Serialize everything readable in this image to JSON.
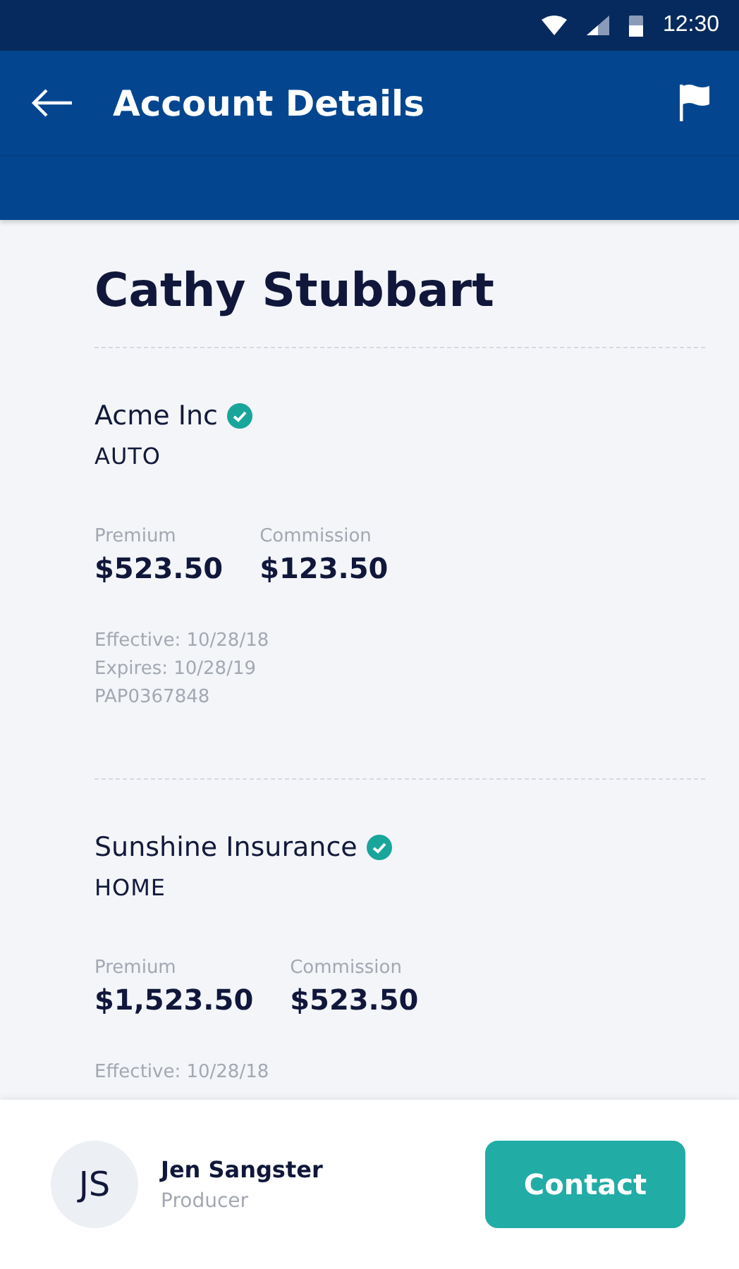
{
  "status_bar": {
    "time": "12:30"
  },
  "app_bar": {
    "title": "Account Details"
  },
  "account": {
    "name": "Cathy Stubbart"
  },
  "policies": [
    {
      "company": "Acme Inc",
      "verified": true,
      "line": "AUTO",
      "premium_label": "Premium",
      "premium": "$523.50",
      "commission_label": "Commission",
      "commission": "$123.50",
      "details": [
        "Effective: 10/28/18",
        "Expires: 10/28/19",
        "PAP0367848"
      ]
    },
    {
      "company": "Sunshine Insurance",
      "verified": true,
      "line": "HOME",
      "premium_label": "Premium",
      "premium": "$1,523.50",
      "commission_label": "Commission",
      "commission": "$523.50",
      "details": [
        "Effective: 10/28/18"
      ]
    }
  ],
  "producer": {
    "initials": "JS",
    "name": "Jen Sangster",
    "role": "Producer"
  },
  "contact_button": "Contact"
}
